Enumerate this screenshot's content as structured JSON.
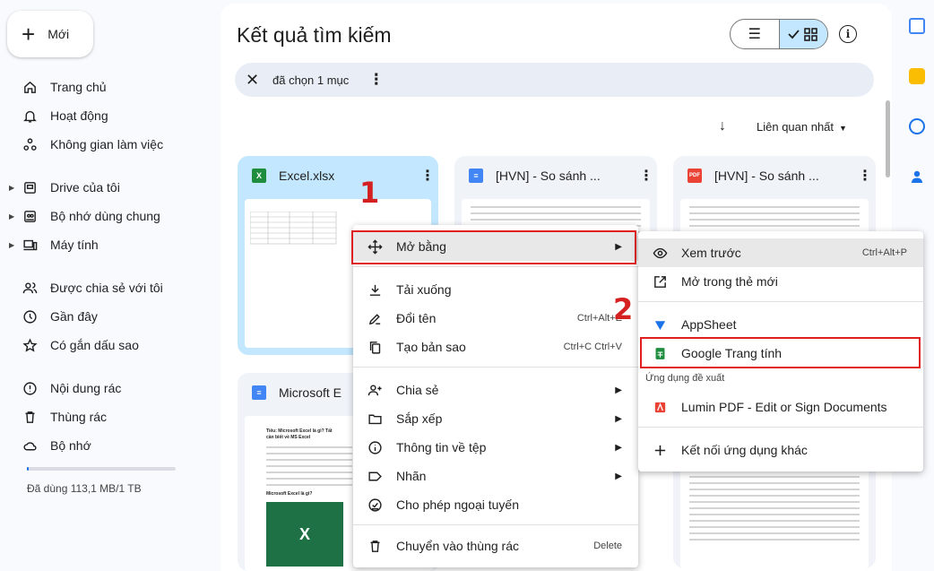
{
  "sidebar": {
    "new_label": "Mới",
    "items": [
      {
        "label": "Trang chủ",
        "icon": "home-icon"
      },
      {
        "label": "Hoạt động",
        "icon": "bell-icon"
      },
      {
        "label": "Không gian làm việc",
        "icon": "workspace-icon"
      },
      {
        "label": "Drive của tôi",
        "icon": "drive-icon"
      },
      {
        "label": "Bộ nhớ dùng chung",
        "icon": "shared-drive-icon"
      },
      {
        "label": "Máy tính",
        "icon": "computer-icon"
      },
      {
        "label": "Được chia sẻ với tôi",
        "icon": "people-icon"
      },
      {
        "label": "Gần đây",
        "icon": "clock-icon"
      },
      {
        "label": "Có gắn dấu sao",
        "icon": "star-icon"
      },
      {
        "label": "Nội dung rác",
        "icon": "spam-icon"
      },
      {
        "label": "Thùng rác",
        "icon": "trash-icon"
      },
      {
        "label": "Bộ nhớ",
        "icon": "cloud-icon"
      }
    ],
    "storage_text": "Đã dùng 113,1 MB/1 TB",
    "storage_fraction": 0.0001
  },
  "main": {
    "title": "Kết quả tìm kiếm",
    "selection_text": "đã chọn 1 mục",
    "sort_label": "Liên quan nhất",
    "cards": [
      {
        "name": "Excel.xlsx",
        "type": "sheet"
      },
      {
        "name": "[HVN] - So sánh ...",
        "type": "doc"
      },
      {
        "name": "[HVN] - So sánh ...",
        "type": "pdf"
      },
      {
        "name": "Microsoft E",
        "type": "doc"
      }
    ],
    "thumb_doc_text": [
      "Tiêu: Microsoft Excel là gì? Tất",
      "cần biết về MS Excel",
      "Microsoft Excel là gì?"
    ]
  },
  "context_menu": {
    "items": [
      {
        "label": "Mở bằng",
        "icon": "move-icon",
        "submenu": true
      },
      {
        "label": "Tải xuống",
        "icon": "download-icon"
      },
      {
        "label": "Đổi tên",
        "icon": "edit-icon",
        "shortcut": "Ctrl+Alt+E"
      },
      {
        "label": "Tạo bản sao",
        "icon": "copy-icon",
        "shortcut": "Ctrl+C Ctrl+V"
      },
      {
        "label": "Chia sẻ",
        "icon": "person-add-icon",
        "submenu": true
      },
      {
        "label": "Sắp xếp",
        "icon": "folder-icon",
        "submenu": true
      },
      {
        "label": "Thông tin về tệp",
        "icon": "info-icon",
        "submenu": true
      },
      {
        "label": "Nhãn",
        "icon": "label-icon",
        "submenu": true
      },
      {
        "label": "Cho phép ngoại tuyến",
        "icon": "offline-icon"
      },
      {
        "label": "Chuyển vào thùng rác",
        "icon": "trash-icon",
        "shortcut": "Delete"
      }
    ]
  },
  "submenu": {
    "items": [
      {
        "label": "Xem trước",
        "icon": "eye-icon",
        "shortcut": "Ctrl+Alt+P"
      },
      {
        "label": "Mở trong thẻ mới",
        "icon": "open-new-tab-icon"
      },
      {
        "label": "AppSheet",
        "icon": "appsheet-icon"
      },
      {
        "label": "Google Trang tính",
        "icon": "google-sheets-icon"
      },
      {
        "label": "Lumin PDF - Edit or Sign Documents",
        "icon": "lumin-pdf-icon"
      },
      {
        "label": "Kết nối ứng dụng khác",
        "icon": "plus-icon"
      }
    ],
    "section_label": "Ứng dụng đề xuất"
  },
  "annotations": {
    "step1": "1",
    "step2": "2"
  },
  "colors": {
    "highlight": "#e02020",
    "selected_card": "#c2e7ff",
    "sheets_green": "#1e8e3e",
    "doc_blue": "#4285f4",
    "pdf_red": "#ea4335"
  }
}
